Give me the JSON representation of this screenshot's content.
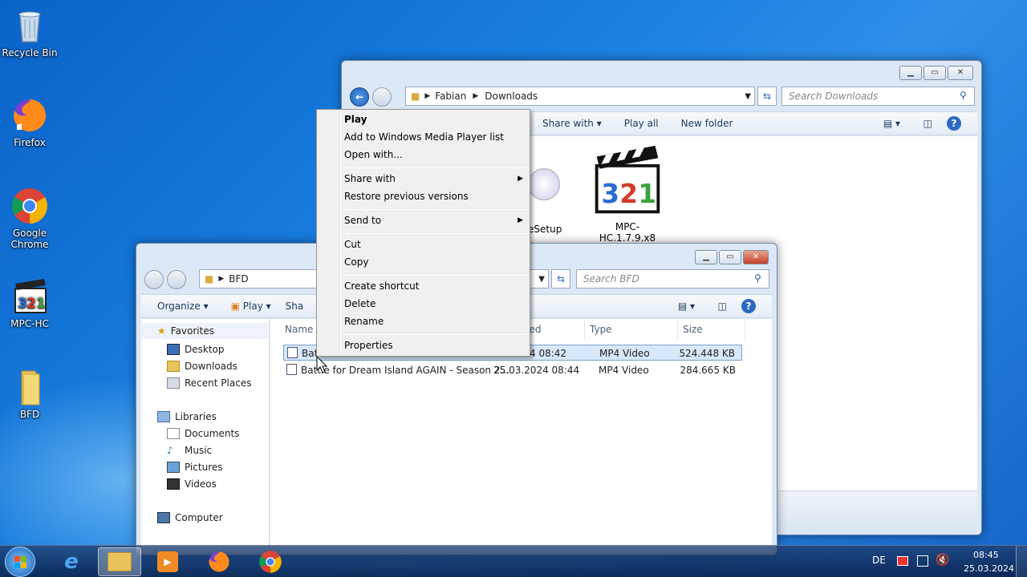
{
  "desktop": {
    "icons": [
      {
        "label": "Recycle Bin",
        "icon": "recycle-bin-icon"
      },
      {
        "label": "Firefox",
        "icon": "firefox-icon"
      },
      {
        "label": "Google Chrome",
        "icon": "chrome-icon"
      },
      {
        "label": "MPC-HC",
        "icon": "mpc-hc-icon"
      },
      {
        "label": "BFD",
        "icon": "folder-icon"
      }
    ]
  },
  "downloads_window": {
    "breadcrumb": [
      "Fabian",
      "Downloads"
    ],
    "search_placeholder": "Search Downloads",
    "toolbar": {
      "share_with": "Share with",
      "play_all": "Play all",
      "new_folder": "New folder"
    },
    "files": [
      {
        "name": "eSetup"
      },
      {
        "name": "MPC-HC.1.7.9.x8\n6"
      }
    ]
  },
  "bfd_window": {
    "breadcrumb": [
      "BFD"
    ],
    "search_placeholder": "Search BFD",
    "toolbar": {
      "organize": "Organize",
      "play": "Play",
      "share": "Sha"
    },
    "nav": {
      "favorites": "Favorites",
      "favorites_items": [
        "Desktop",
        "Downloads",
        "Recent Places"
      ],
      "libraries": "Libraries",
      "libraries_items": [
        "Documents",
        "Music",
        "Pictures",
        "Videos"
      ],
      "computer": "Computer"
    },
    "columns": {
      "name": "Name",
      "modified": "dified",
      "type": "Type",
      "size": "Size"
    },
    "rows": [
      {
        "name": "Batt",
        "date": "4 08:42",
        "type": "MP4 Video",
        "size": "524.448 KB"
      },
      {
        "name": "Battle for Dream Island AGAIN - Season 2...",
        "date": "25.03.2024 08:44",
        "type": "MP4 Video",
        "size": "284.665 KB"
      }
    ]
  },
  "context_menu": {
    "play": "Play",
    "add_wmp": "Add to Windows Media Player list",
    "open_with": "Open with...",
    "share_with": "Share with",
    "restore": "Restore previous versions",
    "send_to": "Send to",
    "cut": "Cut",
    "copy": "Copy",
    "create_shortcut": "Create shortcut",
    "delete": "Delete",
    "rename": "Rename",
    "properties": "Properties"
  },
  "taskbar": {
    "language": "DE",
    "time": "08:45",
    "date": "25.03.2024"
  },
  "colors": {
    "accent": "#1a7fe0",
    "selection": "#d7e8fb",
    "close_button": "#c4402a"
  }
}
